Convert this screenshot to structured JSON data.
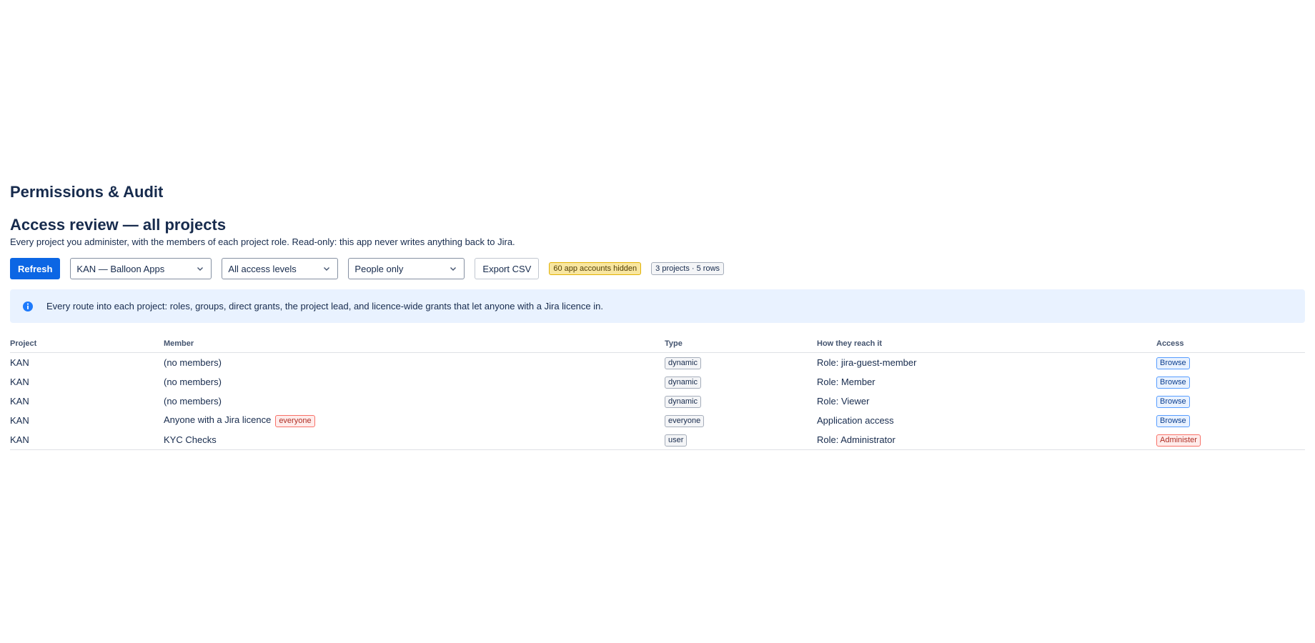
{
  "app": {
    "title": "Permissions & Audit"
  },
  "section": {
    "title": "Access review — all projects",
    "subtitle": "Every project you administer, with the members of each project role. Read-only: this app never writes anything back to Jira."
  },
  "toolbar": {
    "refresh_label": "Refresh",
    "project_select": {
      "value": "KAN — Balloon Apps"
    },
    "access_select": {
      "value": "All access levels"
    },
    "people_select": {
      "value": "People only"
    },
    "export_label": "Export CSV",
    "hidden_badge": "60 app accounts hidden",
    "count_badge": "3 projects · 5 rows"
  },
  "info": {
    "icon": "info-icon",
    "text": "Every route into each project: roles, groups, direct grants, the project lead, and licence-wide grants that let anyone with a Jira licence in."
  },
  "table": {
    "headers": {
      "project": "Project",
      "member": "Member",
      "type": "Type",
      "how": "How they reach it",
      "access": "Access"
    },
    "rows": [
      {
        "project": "KAN",
        "member": "(no members)",
        "member_tag": "",
        "type": "dynamic",
        "how": "Role: jira-guest-member",
        "access": "Browse"
      },
      {
        "project": "KAN",
        "member": "(no members)",
        "member_tag": "",
        "type": "dynamic",
        "how": "Role: Member",
        "access": "Browse"
      },
      {
        "project": "KAN",
        "member": "(no members)",
        "member_tag": "",
        "type": "dynamic",
        "how": "Role: Viewer",
        "access": "Browse"
      },
      {
        "project": "KAN",
        "member": "Anyone with a Jira licence",
        "member_tag": "everyone",
        "type": "everyone",
        "how": "Application access",
        "access": "Browse"
      },
      {
        "project": "KAN",
        "member": "KYC Checks",
        "member_tag": "",
        "type": "user",
        "how": "Role: Administrator",
        "access": "Administer"
      }
    ]
  },
  "colors": {
    "primary": "#0c66e4",
    "info_bg": "#e9f2ff",
    "warning_bg": "#f8e6a0",
    "danger": "#ae2e24",
    "browse": "#0c3f8f"
  }
}
